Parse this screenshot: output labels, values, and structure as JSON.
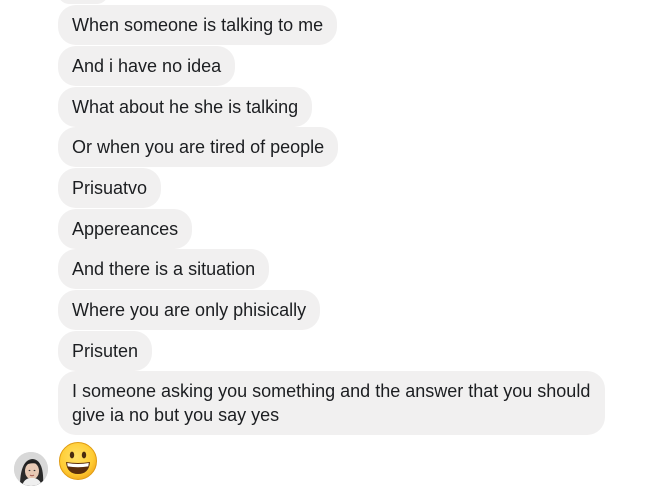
{
  "messages": [
    "When someone is talking to me",
    "And i have no idea",
    "What about he she is talking",
    "Or when you are tired of people",
    "Prisuatvo",
    "Appereances",
    "And there is a situation",
    "Where you are only phisically",
    "Prisuten",
    "I someone asking you something and the answer that you should give ia no but you say yes"
  ],
  "sender_avatar": "profile-photo",
  "last_reaction": "grinning-face-emoji",
  "colors": {
    "bubble_bg": "#f1f0f0",
    "text": "#1c1e21",
    "emoji_face": "#ffcc33"
  }
}
